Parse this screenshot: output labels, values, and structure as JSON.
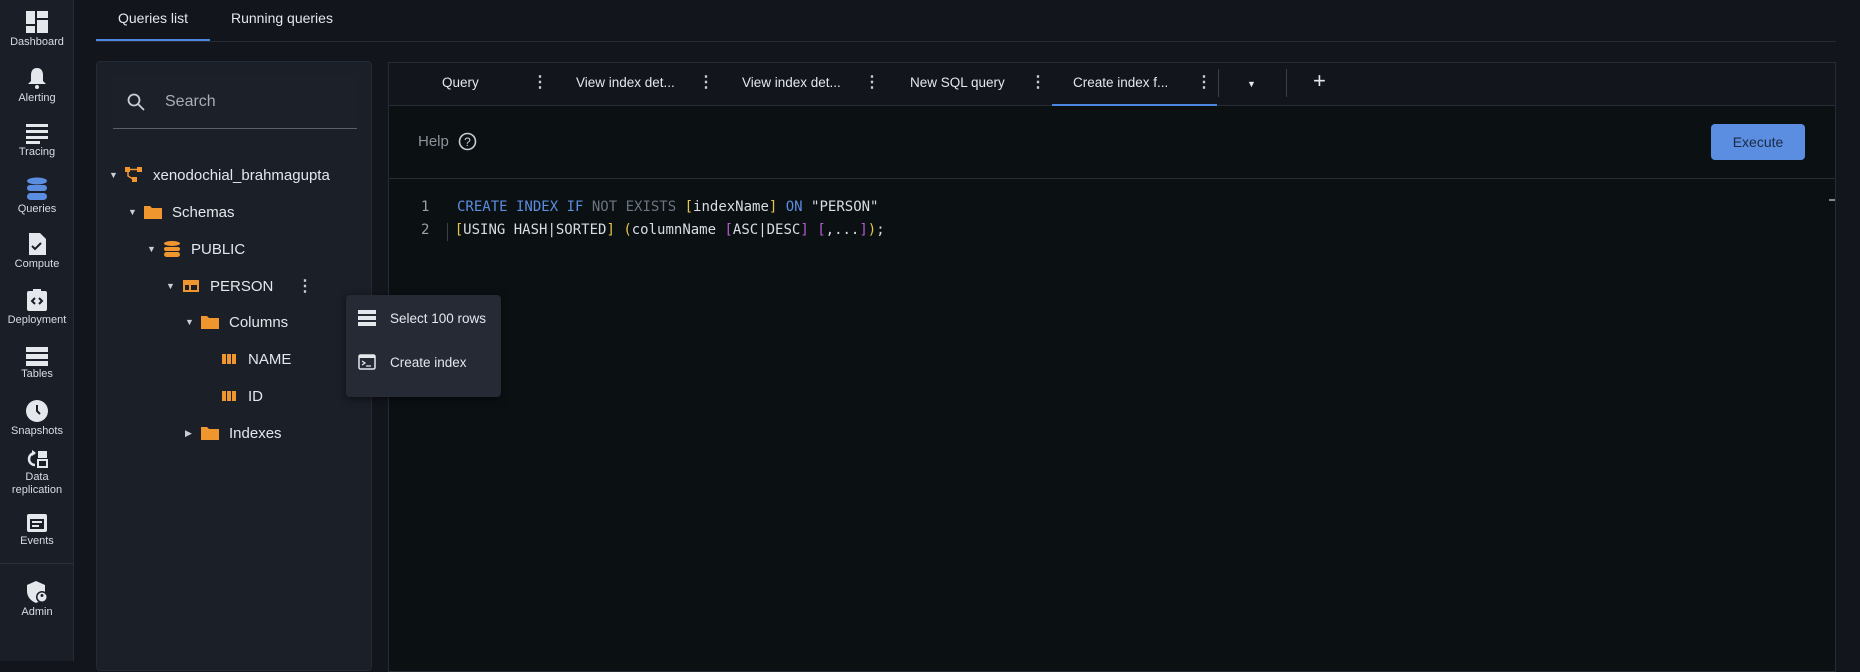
{
  "sidebar": {
    "items": [
      {
        "label": "Dashboard",
        "icon": "dashboard-icon"
      },
      {
        "label": "Alerting",
        "icon": "bell-icon"
      },
      {
        "label": "Tracing",
        "icon": "lines-icon"
      },
      {
        "label": "Queries",
        "icon": "database-icon",
        "active": true
      },
      {
        "label": "Compute",
        "icon": "task-file-icon"
      },
      {
        "label": "Deployment",
        "icon": "code-clipboard-icon"
      },
      {
        "label": "Tables",
        "icon": "table-rows-icon"
      },
      {
        "label": "Snapshots",
        "icon": "clock-icon"
      },
      {
        "label": "Data",
        "label2": "replication",
        "icon": "replication-icon"
      },
      {
        "label": "Events",
        "icon": "calendar-icon"
      },
      {
        "label": "Admin",
        "icon": "admin-shield-icon"
      }
    ]
  },
  "top_tabs": [
    "Queries list",
    "Running queries"
  ],
  "search": {
    "placeholder": "Search"
  },
  "tree": [
    {
      "label": "xenodochial_brahmagupta",
      "icon": "cluster-icon",
      "expanded": true
    },
    {
      "label": "Schemas",
      "icon": "folder-icon",
      "expanded": true
    },
    {
      "label": "PUBLIC",
      "icon": "schema-database-icon",
      "expanded": true
    },
    {
      "label": "PERSON",
      "icon": "table-icon",
      "expanded": true
    },
    {
      "label": "Columns",
      "icon": "folder-icon",
      "expanded": true
    },
    {
      "label": "NAME",
      "icon": "column-icon"
    },
    {
      "label": "ID",
      "icon": "column-icon"
    },
    {
      "label": "Indexes",
      "icon": "folder-icon",
      "expanded": false
    }
  ],
  "context_menu": [
    {
      "label": "Select 100 rows",
      "icon": "rows-icon"
    },
    {
      "label": "Create index",
      "icon": "terminal-icon"
    }
  ],
  "editor_tabs": [
    {
      "label": "Query"
    },
    {
      "label": "View index det..."
    },
    {
      "label": "View index det..."
    },
    {
      "label": "New SQL query"
    },
    {
      "label": "Create index f...",
      "active": true
    }
  ],
  "help_label": "Help",
  "execute_label": "Execute",
  "code": {
    "line_numbers": [
      "1",
      "2"
    ],
    "line1": {
      "a": "CREATE INDEX IF",
      "b": " NOT EXISTS ",
      "c": "[",
      "d": "indexName",
      "e": "]",
      "f": " ON ",
      "g": "\"PERSON\""
    },
    "line2": {
      "a": "    [",
      "b": "USING HASH|SORTED",
      "c": "]",
      "d": " (",
      "e": "columnName ",
      "f": "[",
      "g": "ASC|DESC",
      "h": "]",
      "i": " [",
      "j": ",...",
      "k": "]",
      "l": ")",
      "m": ";"
    }
  },
  "colors": {
    "accent": "#5b8de0",
    "tree_icon": "#f0962e"
  }
}
